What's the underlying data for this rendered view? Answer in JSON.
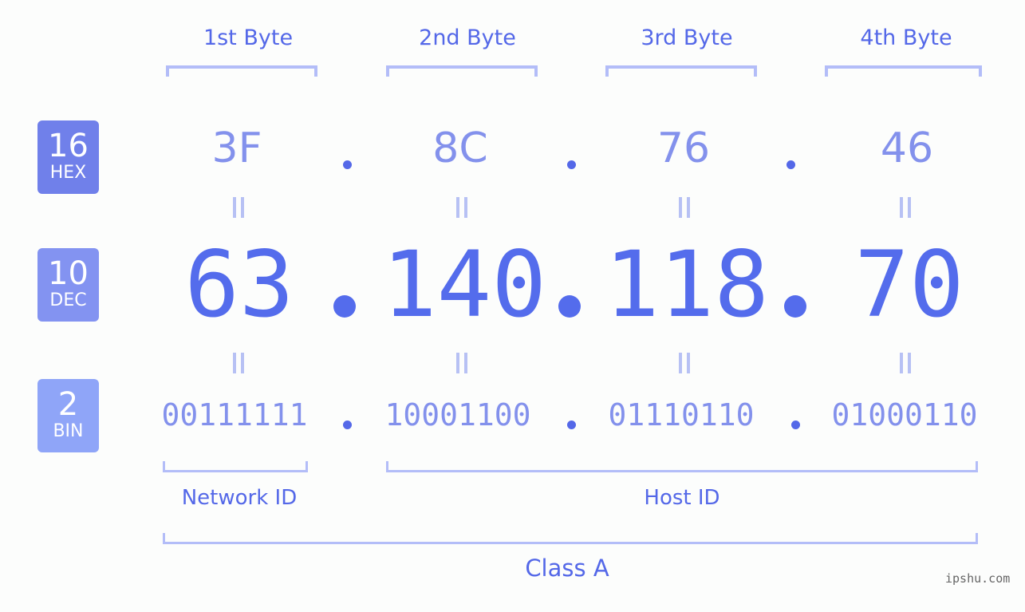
{
  "bytes": [
    {
      "label": "1st Byte",
      "hex": "3F",
      "dec": "63",
      "bin": "00111111"
    },
    {
      "label": "2nd Byte",
      "hex": "8C",
      "dec": "140",
      "bin": "10001100"
    },
    {
      "label": "3rd Byte",
      "hex": "76",
      "dec": "118",
      "bin": "01110110"
    },
    {
      "label": "4th Byte",
      "hex": "46",
      "dec": "70",
      "bin": "01000110"
    }
  ],
  "badges": {
    "hex": {
      "num": "16",
      "label": "HEX",
      "color": "#7080ea"
    },
    "dec": {
      "num": "10",
      "label": "DEC",
      "color": "#8393f1"
    },
    "bin": {
      "num": "2",
      "label": "BIN",
      "color": "#8fa5f8"
    }
  },
  "separator": ".",
  "segments": {
    "network": "Network ID",
    "host": "Host ID",
    "class": "Class A"
  },
  "colors": {
    "accent": "#5468e8",
    "light_value": "#8391ec",
    "bracket": "#b3bdf8"
  },
  "watermark": "ipshu.com"
}
